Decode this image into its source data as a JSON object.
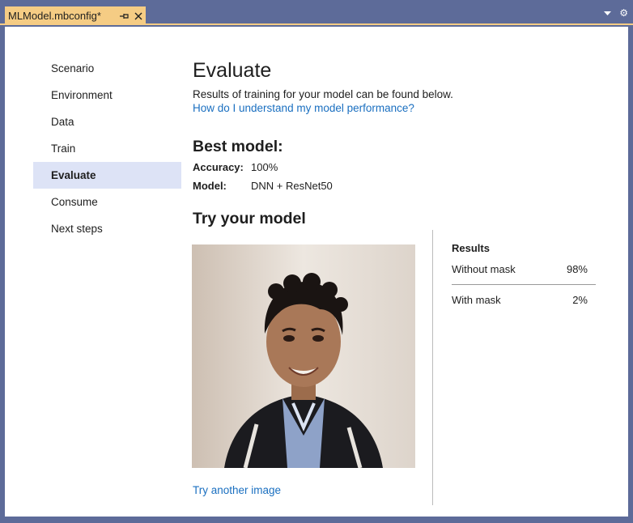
{
  "tab": {
    "title": "MLModel.mbconfig*",
    "pin_icon": "pin-icon",
    "close_icon": "close-icon"
  },
  "tabstrip": {
    "dropdown_icon": "chevron-down-icon",
    "settings_icon": "gear-icon"
  },
  "nav": {
    "items": [
      "Scenario",
      "Environment",
      "Data",
      "Train",
      "Evaluate",
      "Consume",
      "Next steps"
    ],
    "active_index": 4
  },
  "evaluate": {
    "title": "Evaluate",
    "description": "Results of training for your model can be found below.",
    "help_link": "How do I understand my model performance?"
  },
  "best_model": {
    "title": "Best model:",
    "accuracy_label": "Accuracy:",
    "accuracy_value": "100%",
    "model_label": "Model:",
    "model_value": "DNN + ResNet50"
  },
  "try_model": {
    "title": "Try your model",
    "photo_icon": "portrait-photo",
    "try_another": "Try another image"
  },
  "results": {
    "heading": "Results",
    "rows": [
      {
        "label": "Without mask",
        "value": "98%"
      },
      {
        "label": "With mask",
        "value": "2%"
      }
    ]
  },
  "colors": {
    "accent_tab": "#f5cc84",
    "frame": "#5d6b99",
    "link": "#1a6fc0",
    "nav_active": "#dde3f6"
  }
}
